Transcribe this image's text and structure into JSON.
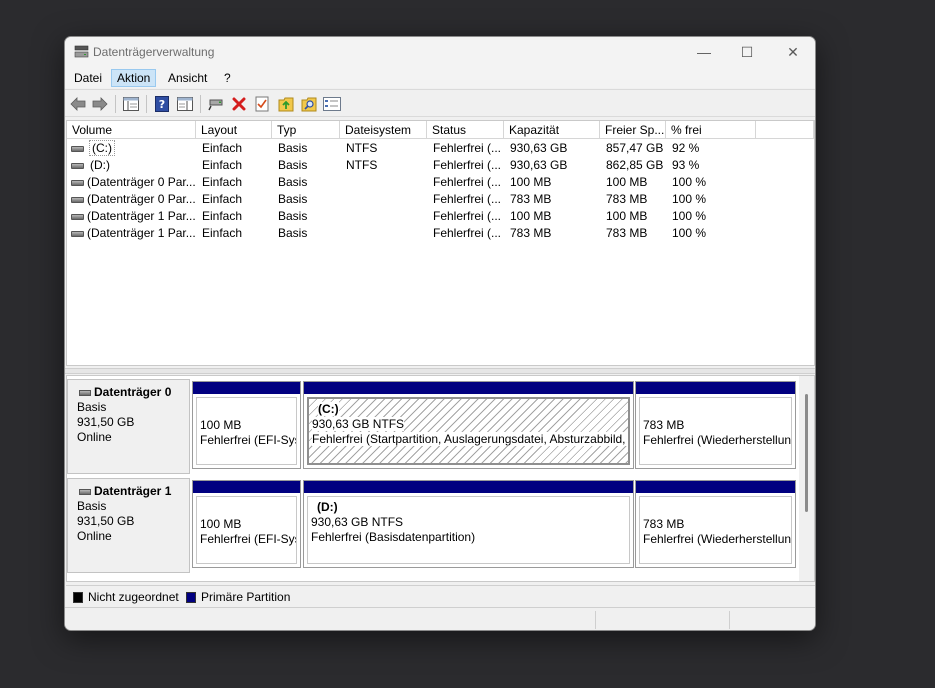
{
  "window": {
    "title": "Datenträgerverwaltung",
    "minimize": "—",
    "maximize": "☐",
    "close": "✕"
  },
  "menu": [
    "Datei",
    "Aktion",
    "Ansicht",
    "?"
  ],
  "toolbar_icons": [
    "back-arrow-icon",
    "forward-arrow-icon",
    "console-tree-icon",
    "help-icon",
    "properties-view-icon",
    "connect-icon",
    "delete-icon",
    "check-icon",
    "up-folder-icon",
    "search-folder-icon",
    "settings-list-icon"
  ],
  "list": {
    "columns": [
      "Volume",
      "Layout",
      "Typ",
      "Dateisystem",
      "Status",
      "Kapazität",
      "Freier Sp...",
      "% frei"
    ],
    "rows": [
      [
        "(C:)",
        "Einfach",
        "Basis",
        "NTFS",
        "Fehlerfrei (...",
        "930,63 GB",
        "857,47 GB",
        "92 %"
      ],
      [
        "(D:)",
        "Einfach",
        "Basis",
        "NTFS",
        "Fehlerfrei (...",
        "930,63 GB",
        "862,85 GB",
        "93 %"
      ],
      [
        "(Datenträger 0 Par...",
        "Einfach",
        "Basis",
        "",
        "Fehlerfrei (...",
        "100 MB",
        "100 MB",
        "100 %"
      ],
      [
        "(Datenträger 0 Par...",
        "Einfach",
        "Basis",
        "",
        "Fehlerfrei (...",
        "783 MB",
        "783 MB",
        "100 %"
      ],
      [
        "(Datenträger 1 Par...",
        "Einfach",
        "Basis",
        "",
        "Fehlerfrei (...",
        "100 MB",
        "100 MB",
        "100 %"
      ],
      [
        "(Datenträger 1 Par...",
        "Einfach",
        "Basis",
        "",
        "Fehlerfrei (...",
        "783 MB",
        "783 MB",
        "100 %"
      ]
    ]
  },
  "disks": [
    {
      "name": "Datenträger 0",
      "type": "Basis",
      "size": "931,50 GB",
      "state": "Online",
      "partitions": [
        {
          "name": "",
          "size": "100 MB",
          "status": "Fehlerfrei (EFI-Syst"
        },
        {
          "name": "(C:)",
          "size": "930,63 GB NTFS",
          "status": "Fehlerfrei (Startpartition, Auslagerungsdatei, Absturzabbild, I"
        },
        {
          "name": "",
          "size": "783 MB",
          "status": "Fehlerfrei (Wiederherstellun"
        }
      ]
    },
    {
      "name": "Datenträger 1",
      "type": "Basis",
      "size": "931,50 GB",
      "state": "Online",
      "partitions": [
        {
          "name": "",
          "size": "100 MB",
          "status": "Fehlerfrei (EFI-Syst"
        },
        {
          "name": "(D:)",
          "size": "930,63 GB NTFS",
          "status": "Fehlerfrei (Basisdatenpartition)"
        },
        {
          "name": "",
          "size": "783 MB",
          "status": "Fehlerfrei (Wiederherstellun"
        }
      ]
    }
  ],
  "legend": [
    {
      "label": "Nicht zugeordnet",
      "color": "#000000"
    },
    {
      "label": "Primäre Partition",
      "color": "#010080"
    }
  ]
}
